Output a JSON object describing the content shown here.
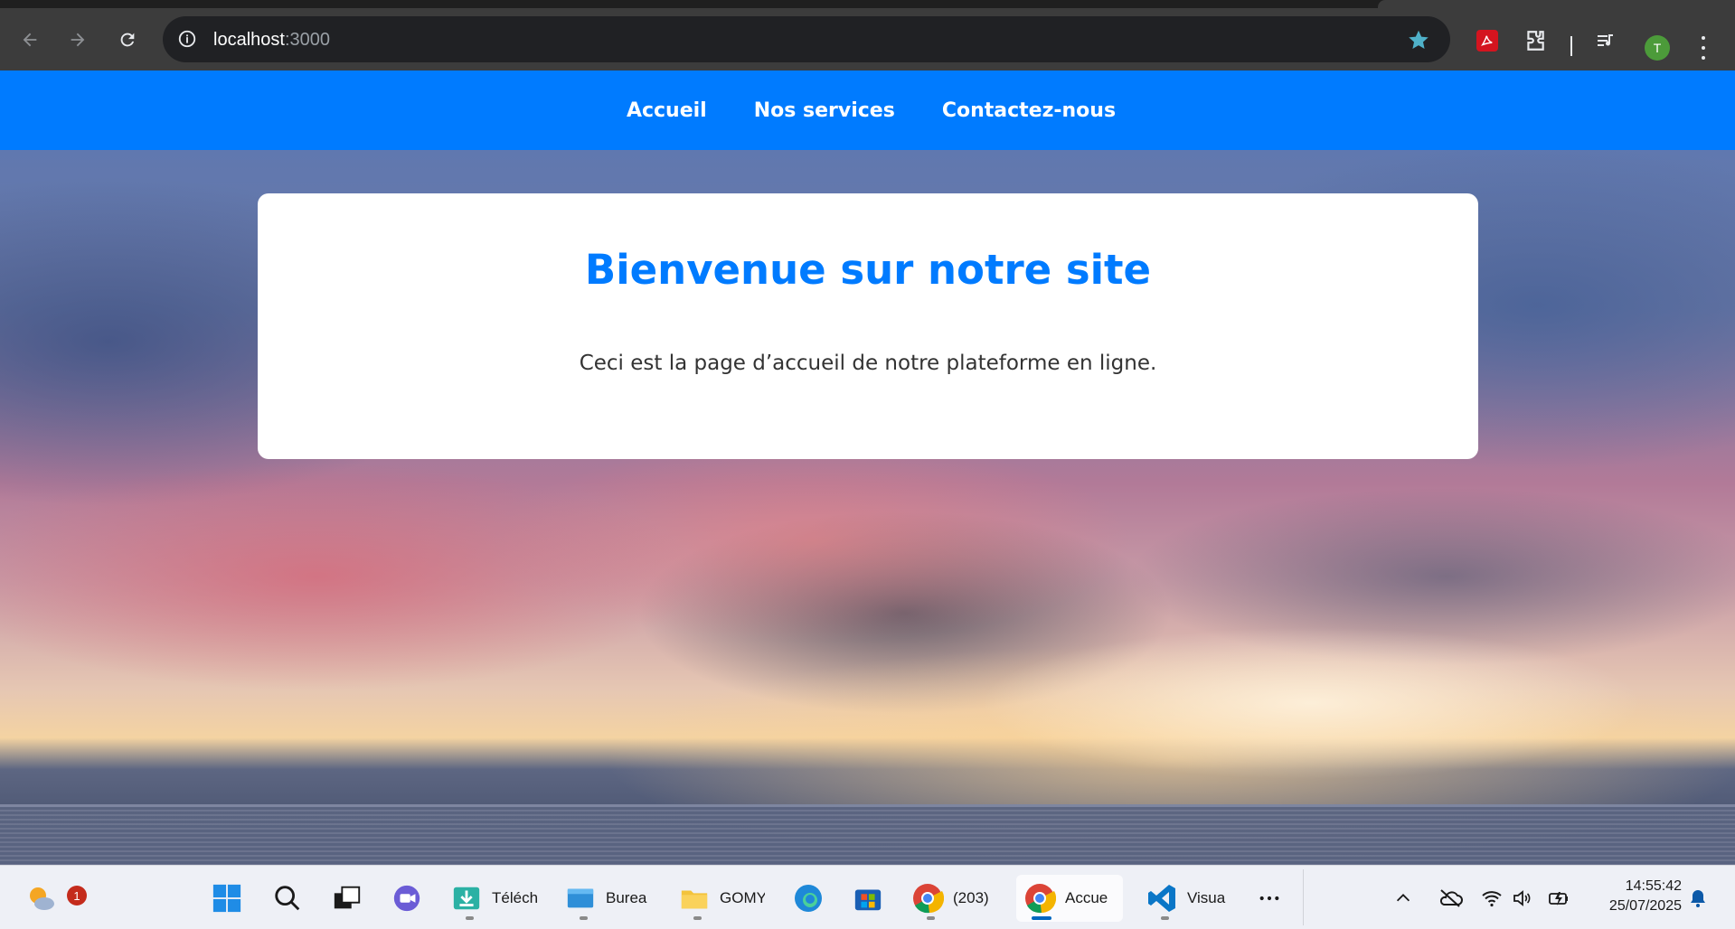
{
  "browser": {
    "url_host": "localhost",
    "url_port": ":3000",
    "profile_initial": "T",
    "icons": [
      "back-icon",
      "forward-icon",
      "reload-icon",
      "info-icon",
      "star-icon",
      "pdf-extension-icon",
      "extensions-icon",
      "media-control-icon",
      "menu-icon"
    ]
  },
  "nav": {
    "items": [
      "Accueil",
      "Nos services",
      "Contactez-nous"
    ]
  },
  "card": {
    "title": "Bienvenue sur notre site",
    "text": "Ceci est la page d’accueil de notre plateforme en ligne."
  },
  "colors": {
    "primary": "#007bff",
    "card_bg": "#ffffff",
    "text": "#333333"
  },
  "taskbar": {
    "weather_badge": "1",
    "apps": [
      {
        "name": "start-icon",
        "label": ""
      },
      {
        "name": "search-icon",
        "label": ""
      },
      {
        "name": "task-view-icon",
        "label": ""
      },
      {
        "name": "teams-meet-icon",
        "label": ""
      },
      {
        "name": "downloads-icon",
        "label": "Téléch"
      },
      {
        "name": "desktop-folder-icon",
        "label": "Burea"
      },
      {
        "name": "folder-icon",
        "label": "GOMY"
      },
      {
        "name": "edge-icon",
        "label": ""
      },
      {
        "name": "store-icon",
        "label": ""
      },
      {
        "name": "chrome-icon",
        "label": "(203) "
      },
      {
        "name": "chrome-active-icon",
        "label": "Accue"
      },
      {
        "name": "vscode-icon",
        "label": "Visua"
      },
      {
        "name": "more-icon",
        "label": ""
      }
    ],
    "time": "14:55:42",
    "date": "25/07/2025"
  }
}
